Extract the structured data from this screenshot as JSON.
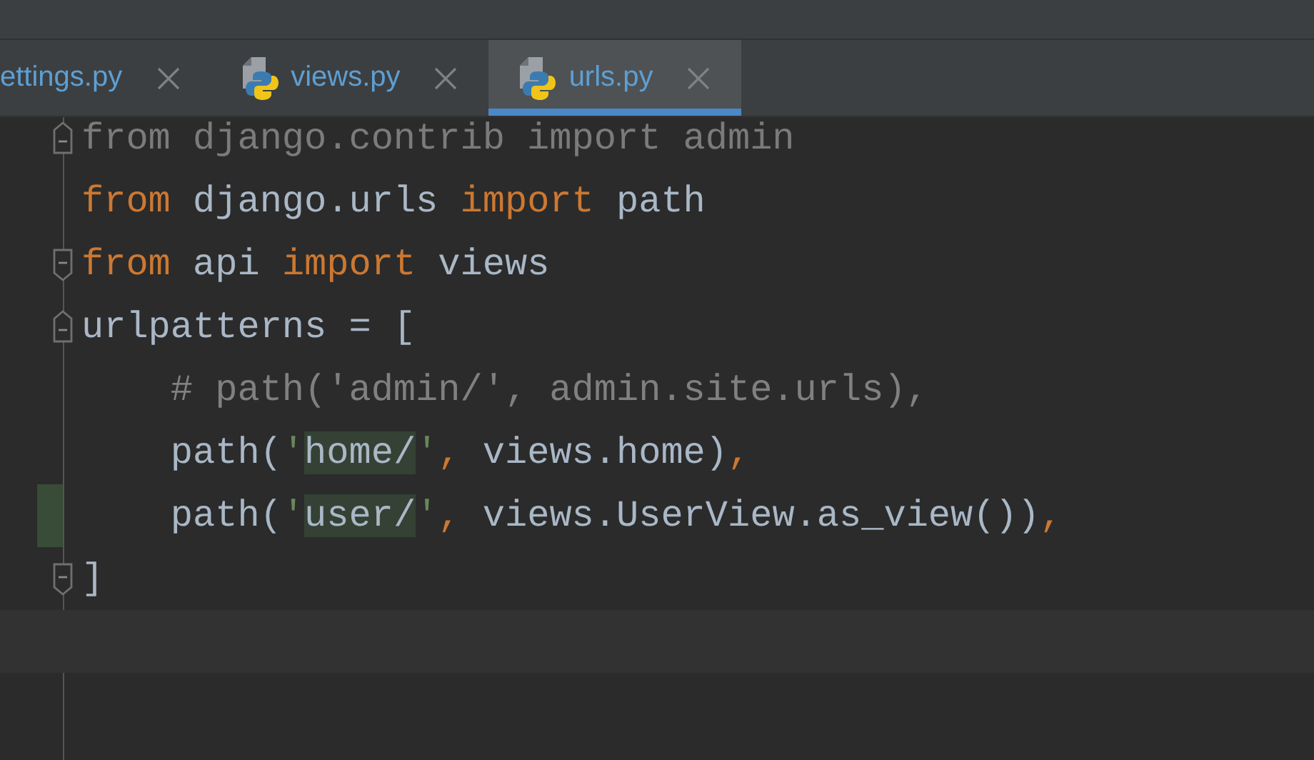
{
  "tabs": [
    {
      "label": "ettings.py",
      "selected": false,
      "icon": false
    },
    {
      "label": "views.py",
      "selected": false,
      "icon": true
    },
    {
      "label": "urls.py",
      "selected": true,
      "icon": true
    }
  ],
  "editor": {
    "lines": [
      {
        "fold_start": true,
        "tokens": [
          {
            "kind": "unused",
            "text": "from django.contrib import admin"
          }
        ]
      },
      {
        "tokens": [
          {
            "kind": "keyword",
            "text": "from"
          },
          {
            "kind": "plain",
            "text": " django.urls "
          },
          {
            "kind": "keyword",
            "text": "import"
          },
          {
            "kind": "plain",
            "text": " path"
          }
        ]
      },
      {
        "fold_end": true,
        "tokens": [
          {
            "kind": "keyword",
            "text": "from"
          },
          {
            "kind": "plain",
            "text": " api "
          },
          {
            "kind": "keyword",
            "text": "import"
          },
          {
            "kind": "plain",
            "text": " views"
          }
        ]
      },
      {
        "fold_start": true,
        "tokens": [
          {
            "kind": "plain",
            "text": "urlpatterns = ["
          }
        ]
      },
      {
        "tokens": [
          {
            "kind": "comment",
            "text": "    # path('admin/', admin.site.urls),"
          }
        ]
      },
      {
        "tokens": [
          {
            "kind": "plain",
            "text": "    path("
          },
          {
            "kind": "string",
            "text": "'"
          },
          {
            "kind": "match",
            "text": "home/"
          },
          {
            "kind": "string",
            "text": "'"
          },
          {
            "kind": "keyword",
            "text": ","
          },
          {
            "kind": "plain",
            "text": " views.home)"
          },
          {
            "kind": "keyword",
            "text": ","
          }
        ]
      },
      {
        "changed": true,
        "tokens": [
          {
            "kind": "plain",
            "text": "    path("
          },
          {
            "kind": "string",
            "text": "'"
          },
          {
            "kind": "match",
            "text": "user/"
          },
          {
            "kind": "string",
            "text": "'"
          },
          {
            "kind": "keyword",
            "text": ","
          },
          {
            "kind": "plain",
            "text": " views.UserView.as_view())"
          },
          {
            "kind": "keyword",
            "text": ","
          }
        ]
      },
      {
        "fold_end": true,
        "tokens": [
          {
            "kind": "plain",
            "text": "]"
          }
        ]
      },
      {
        "current": true
      }
    ]
  }
}
